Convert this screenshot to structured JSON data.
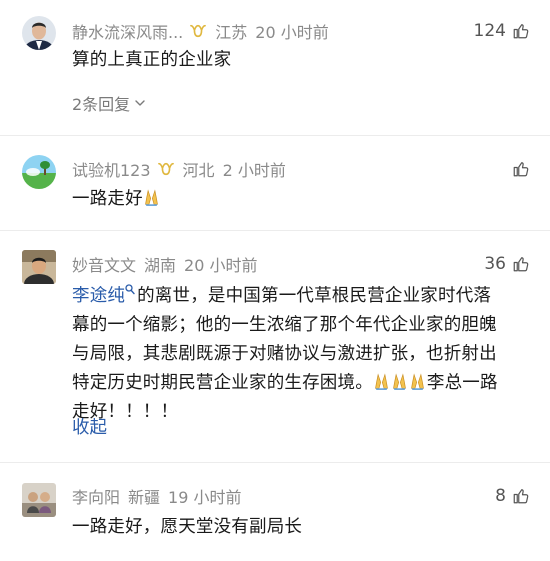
{
  "comments": [
    {
      "author": "静水流深风雨...",
      "location": "江苏",
      "time": "20 小时前",
      "likes": "124",
      "text": "算的上真正的企业家",
      "replies_label": "2条回复"
    },
    {
      "author": "试验机123",
      "location": "河北",
      "time": "2 小时前",
      "likes": "",
      "text": "一路走好"
    },
    {
      "author": "妙音文文",
      "location": "湖南",
      "time": "20 小时前",
      "likes": "36",
      "mention": "李途纯",
      "text_line1": "的离世，是中国第一代草根民营企业家时代落",
      "text_line2": "幕的一个缩影；他的一生浓缩了那个年代企业家的胆魄",
      "text_line3": "与局限，其悲剧既源于对赌协议与激进扩张，也折射出",
      "text_line4_a": "特定历史时期民营企业家的生存困境。",
      "text_line4_b": "李总一路",
      "text_line5": "走好！！！！",
      "collapse_label": "收起"
    },
    {
      "author": "李向阳",
      "location": "新疆",
      "time": "19 小时前",
      "likes": "8",
      "text": "一路走好，愿天堂没有副局长"
    }
  ],
  "colors": {
    "meta_gray": "#8a8a8a",
    "link_blue": "#2a5caa",
    "badge_gold": "#e0b840"
  }
}
